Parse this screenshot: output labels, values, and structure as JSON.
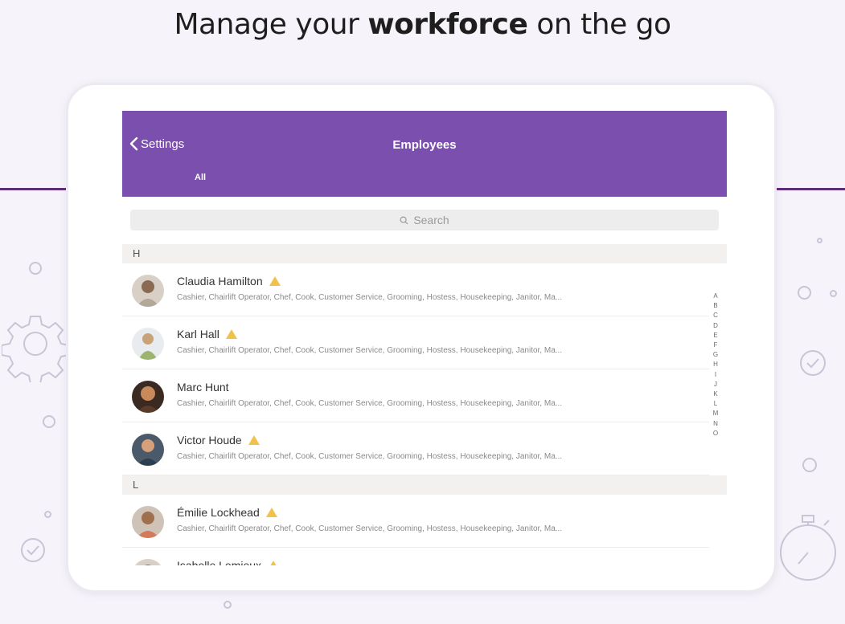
{
  "headline": {
    "part1": "Manage",
    "part2": "your",
    "part3": "workforce",
    "part4": "on the go"
  },
  "navbar": {
    "back_label": "Settings",
    "title": "Employees",
    "filter_tab": "All"
  },
  "search": {
    "placeholder": "Search"
  },
  "sections": [
    {
      "letter": "H",
      "employees": [
        {
          "name": "Claudia Hamilton",
          "warning": true,
          "roles": "Cashier, Chairlift Operator, Chef, Cook, Customer Service, Grooming, Hostess, Housekeeping, Janitor, Ma..."
        },
        {
          "name": "Karl Hall",
          "warning": true,
          "roles": "Cashier, Chairlift Operator, Chef, Cook, Customer Service, Grooming, Hostess, Housekeeping, Janitor, Ma..."
        },
        {
          "name": "Marc Hunt",
          "warning": false,
          "roles": "Cashier, Chairlift Operator, Chef, Cook, Customer Service, Grooming, Hostess, Housekeeping, Janitor, Ma..."
        },
        {
          "name": "Victor Houde",
          "warning": true,
          "roles": "Cashier, Chairlift Operator, Chef, Cook, Customer Service, Grooming, Hostess, Housekeeping, Janitor, Ma..."
        }
      ]
    },
    {
      "letter": "L",
      "employees": [
        {
          "name": "Émilie Lockhead",
          "warning": true,
          "roles": "Cashier, Chairlift Operator, Chef, Cook, Customer Service, Grooming, Hostess, Housekeeping, Janitor, Ma..."
        },
        {
          "name": "Isabelle Lemieux",
          "warning": true,
          "roles": ""
        }
      ]
    }
  ],
  "alphabet_index": [
    "A",
    "B",
    "C",
    "D",
    "E",
    "F",
    "G",
    "H",
    "I",
    "J",
    "K",
    "L",
    "M",
    "N",
    "O"
  ],
  "colors": {
    "navbar": "#7b4fae",
    "accent_line": "#5c2d7a",
    "warning": "#f0c24a"
  }
}
